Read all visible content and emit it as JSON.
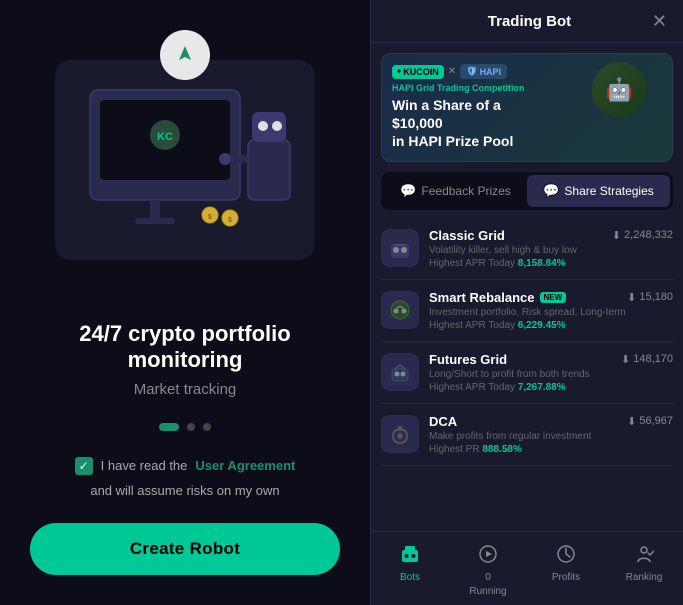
{
  "left": {
    "main_text": "24/7 crypto portfolio monitoring",
    "sub_text": "Market tracking",
    "checkbox_text": "I have read the",
    "user_agreement": "User Agreement",
    "checkbox_suffix": "and will assume risks on my own",
    "create_button": "Create Robot",
    "dots": [
      "active",
      "inactive",
      "inactive"
    ]
  },
  "right": {
    "modal_title": "Trading Bot",
    "close_label": "✕",
    "banner": {
      "kucoin": "KUCOIN",
      "hapi": "HAPI",
      "competition_label": "HAPI Grid Trading Competition",
      "title_line1": "Win a Share of a $10,000",
      "title_line2": "in HAPI Prize Pool"
    },
    "tabs": [
      {
        "id": "feedback",
        "label": "Feedback Prizes",
        "icon": "💬",
        "active": false
      },
      {
        "id": "share",
        "label": "Share Strategies",
        "icon": "💬",
        "active": true
      }
    ],
    "strategies": [
      {
        "name": "Classic Grid",
        "icon": "🤖",
        "downloads": "2,248,332",
        "desc": "Volatility killer, sell high & buy low",
        "apr_label": "Highest APR Today",
        "apr": "8,158.84%",
        "new": false
      },
      {
        "name": "Smart Rebalance",
        "icon": "🤖",
        "downloads": "15,180",
        "desc": "Investment portfolio, Risk spread, Long-term",
        "apr_label": "Highest APR Today",
        "apr": "6,229.45%",
        "new": true
      },
      {
        "name": "Futures Grid",
        "icon": "🤖",
        "downloads": "148,170",
        "desc": "Long/Short to profit from both trends",
        "apr_label": "Highest APR Today",
        "apr": "7,267.88%",
        "new": false
      },
      {
        "name": "DCA",
        "icon": "🤖",
        "downloads": "56,967",
        "desc": "Make profits from regular investment",
        "apr_label": "Highest PR",
        "apr": "888.58%",
        "new": false
      }
    ],
    "nav": [
      {
        "id": "bots",
        "icon": "⊞",
        "label": "Bots",
        "active": true
      },
      {
        "id": "running",
        "icon": "▶",
        "label": "Running",
        "count": "0",
        "active": false
      },
      {
        "id": "profits",
        "icon": "◷",
        "label": "Profits",
        "active": false
      },
      {
        "id": "ranking",
        "icon": "⚑",
        "label": "Ranking",
        "active": false
      }
    ]
  }
}
